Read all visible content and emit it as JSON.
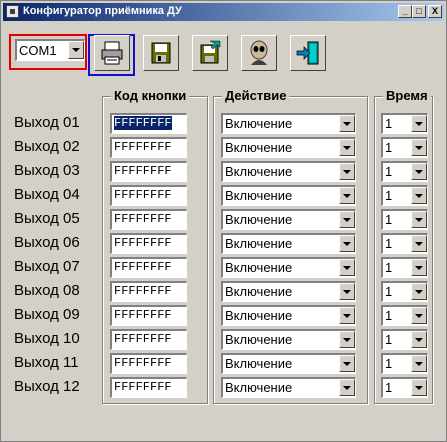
{
  "window": {
    "title": "Конфигуратор приёмника ДУ"
  },
  "titlebar_buttons": {
    "minimize": "_",
    "maximize": "□",
    "close": "X"
  },
  "port": {
    "selected": "COM1"
  },
  "toolbar": [
    "printer-icon",
    "save-icon",
    "save-as-icon",
    "alien-face-icon",
    "exit-door-icon"
  ],
  "groups": {
    "code_header": "Код кнопки",
    "action_header": "Действие",
    "time_header": "Время"
  },
  "rows": [
    {
      "label": "Выход 01",
      "code": "FFFFFFFF",
      "action": "Включение",
      "time": "1"
    },
    {
      "label": "Выход 02",
      "code": "FFFFFFFF",
      "action": "Включение",
      "time": "1"
    },
    {
      "label": "Выход 03",
      "code": "FFFFFFFF",
      "action": "Включение",
      "time": "1"
    },
    {
      "label": "Выход 04",
      "code": "FFFFFFFF",
      "action": "Включение",
      "time": "1"
    },
    {
      "label": "Выход 05",
      "code": "FFFFFFFF",
      "action": "Включение",
      "time": "1"
    },
    {
      "label": "Выход 06",
      "code": "FFFFFFFF",
      "action": "Включение",
      "time": "1"
    },
    {
      "label": "Выход 07",
      "code": "FFFFFFFF",
      "action": "Включение",
      "time": "1"
    },
    {
      "label": "Выход 08",
      "code": "FFFFFFFF",
      "action": "Включение",
      "time": "1"
    },
    {
      "label": "Выход 09",
      "code": "FFFFFFFF",
      "action": "Включение",
      "time": "1"
    },
    {
      "label": "Выход 10",
      "code": "FFFFFFFF",
      "action": "Включение",
      "time": "1"
    },
    {
      "label": "Выход 11",
      "code": "FFFFFFFF",
      "action": "Включение",
      "time": "1"
    },
    {
      "label": "Выход 12",
      "code": "FFFFFFFF",
      "action": "Включение",
      "time": "1"
    }
  ]
}
